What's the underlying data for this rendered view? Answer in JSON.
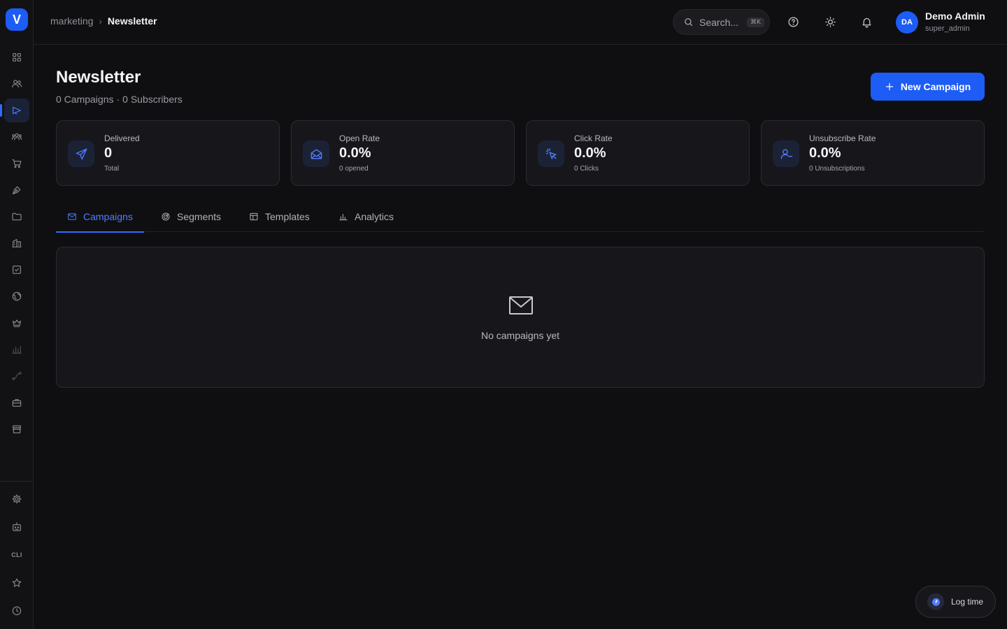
{
  "app": {
    "logo_letter": "V",
    "accent_color": "#1d5cf5"
  },
  "sidebar": {
    "items": [
      {
        "icon": "grid-icon",
        "active": false
      },
      {
        "icon": "users-icon",
        "active": false
      },
      {
        "icon": "megaphone-icon",
        "active": true
      },
      {
        "icon": "team-icon",
        "active": false
      },
      {
        "icon": "cart-icon",
        "active": false
      },
      {
        "icon": "pen-tool-icon",
        "active": false
      },
      {
        "icon": "folder-icon",
        "active": false
      },
      {
        "icon": "building-icon",
        "active": false
      },
      {
        "icon": "checkbox-icon",
        "active": false
      },
      {
        "icon": "globe-icon",
        "active": false
      },
      {
        "icon": "crown-icon",
        "active": false
      },
      {
        "icon": "bar-chart-icon",
        "active": false
      },
      {
        "icon": "route-icon",
        "active": false
      },
      {
        "icon": "briefcase-icon",
        "active": false
      },
      {
        "icon": "store-icon",
        "active": false
      }
    ],
    "bottom_items": [
      {
        "icon": "gear-icon"
      },
      {
        "icon": "robot-icon"
      },
      {
        "icon": "cli-icon",
        "label": "CLI"
      },
      {
        "icon": "star-icon"
      },
      {
        "icon": "clock-icon"
      }
    ]
  },
  "topbar": {
    "breadcrumb_parent": "marketing",
    "breadcrumb_current": "Newsletter",
    "search_placeholder": "Search...",
    "search_shortcut": "⌘K",
    "user": {
      "initials": "DA",
      "name": "Demo Admin",
      "role": "super_admin"
    }
  },
  "header": {
    "title": "Newsletter",
    "campaigns_count": "0 Campaigns",
    "separator": "·",
    "subscribers_count": "0 Subscribers",
    "new_campaign_label": "New Campaign"
  },
  "stats": [
    {
      "label": "Delivered",
      "value": "0",
      "foot": "Total",
      "icon": "send-icon"
    },
    {
      "label": "Open Rate",
      "value": "0.0%",
      "foot": "0 opened",
      "icon": "mail-open-icon"
    },
    {
      "label": "Click Rate",
      "value": "0.0%",
      "foot": "0 Clicks",
      "icon": "cursor-click-icon"
    },
    {
      "label": "Unsubscribe Rate",
      "value": "0.0%",
      "foot": "0 Unsubscriptions",
      "icon": "user-minus-icon"
    }
  ],
  "tabs": [
    {
      "label": "Campaigns",
      "icon": "mail-icon",
      "active": true
    },
    {
      "label": "Segments",
      "icon": "target-icon",
      "active": false
    },
    {
      "label": "Templates",
      "icon": "layout-icon",
      "active": false
    },
    {
      "label": "Analytics",
      "icon": "bar-chart-icon",
      "active": false
    }
  ],
  "empty_state": {
    "message": "No campaigns yet",
    "icon": "mail-icon"
  },
  "log_time": {
    "label": "Log time"
  }
}
